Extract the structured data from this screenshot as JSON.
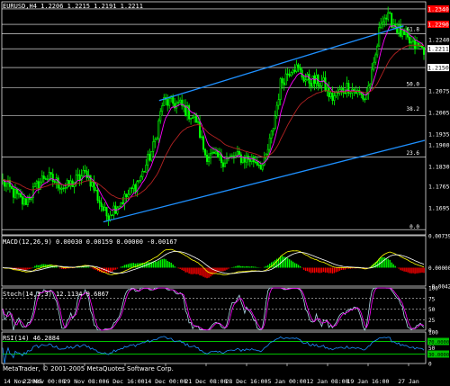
{
  "chart_data": [
    {
      "type": "candlestick",
      "panel": "price",
      "title": "EURUSD,H4  1.2206 1.2215 1.2191 1.2211",
      "ylim": [
        1.1608,
        1.2363
      ],
      "y_ticks": [
        "1.2340",
        "1.2290",
        "1.2240",
        "1.2211",
        "1.2150",
        "1.2075",
        "1.2005",
        "1.1935",
        "1.1900",
        "1.1830",
        "1.1765",
        "1.1695"
      ],
      "price_tags": [
        {
          "label": "1.2340",
          "value": 1.234,
          "color": "#ff0000"
        },
        {
          "label": "1.2290",
          "value": 1.229,
          "color": "#ff0000"
        },
        {
          "label": "1.2211",
          "value": 1.2211,
          "color": "#ffffff"
        },
        {
          "label": "1.2150",
          "value": 1.215,
          "color": "#ffffff"
        }
      ],
      "horizontal_lines": [
        1.234,
        1.229,
        1.226,
        1.2211,
        1.215,
        1.2085,
        1.1995,
        1.186,
        1.1625
      ],
      "fibonacci_levels": [
        {
          "label": "61.8",
          "value": 1.2262
        },
        {
          "label": "50.0",
          "value": 1.2085
        },
        {
          "label": "38.2",
          "value": 1.2004
        },
        {
          "label": "23.6",
          "value": 1.1862
        },
        {
          "label": "0.0",
          "value": 1.1622
        }
      ],
      "channel_lines": [
        {
          "name": "upper",
          "points": [
            [
              0.372,
              1.2043
            ],
            [
              0.95,
              1.2285
            ]
          ],
          "color": "#1e90ff"
        },
        {
          "name": "lower",
          "points": [
            [
              0.24,
              1.165
            ],
            [
              1.0,
              1.1914
            ]
          ],
          "color": "#1e90ff"
        }
      ],
      "ohlc_anchors": [
        [
          0.0,
          1.178
        ],
        [
          0.05,
          1.171
        ],
        [
          0.1,
          1.18
        ],
        [
          0.15,
          1.176
        ],
        [
          0.2,
          1.181
        ],
        [
          0.245,
          1.167
        ],
        [
          0.3,
          1.174
        ],
        [
          0.33,
          1.18
        ],
        [
          0.36,
          1.19
        ],
        [
          0.38,
          1.204
        ],
        [
          0.42,
          1.203
        ],
        [
          0.46,
          1.198
        ],
        [
          0.48,
          1.187
        ],
        [
          0.52,
          1.185
        ],
        [
          0.56,
          1.186
        ],
        [
          0.6,
          1.185
        ],
        [
          0.62,
          1.183
        ],
        [
          0.64,
          1.194
        ],
        [
          0.66,
          1.21
        ],
        [
          0.69,
          1.216
        ],
        [
          0.72,
          1.211
        ],
        [
          0.76,
          1.21
        ],
        [
          0.78,
          1.205
        ],
        [
          0.82,
          1.209
        ],
        [
          0.86,
          1.205
        ],
        [
          0.88,
          1.214
        ],
        [
          0.9,
          1.232
        ],
        [
          0.925,
          1.23
        ],
        [
          0.95,
          1.225
        ],
        [
          0.975,
          1.222
        ],
        [
          1.0,
          1.2211
        ]
      ],
      "moving_averages": [
        {
          "name": "fast",
          "color": "#ff00ff"
        },
        {
          "name": "slow",
          "color": "#b22222"
        }
      ],
      "candle_color": "#00ff00"
    },
    {
      "type": "bar",
      "panel": "macd",
      "title": "MACD(12,26,9) 0.00030 0.00159 0.00000 -0.00167",
      "y_ticks": [
        "0.00739",
        "0.00000",
        "-0.00427"
      ],
      "ylim": [
        -0.00427,
        0.00739
      ],
      "histogram_colors": {
        "positive": "#00ff00",
        "negative": "#ff0000"
      },
      "series": [
        {
          "name": "main",
          "color": "#ffff00"
        },
        {
          "name": "signal",
          "color": "#ffffff"
        }
      ]
    },
    {
      "type": "line",
      "panel": "stochastic",
      "title": "Stoch(14,3,3) 12.1134 9.6867",
      "y_ticks": [
        "100",
        "75",
        "50",
        "25",
        "0"
      ],
      "ylim": [
        0,
        100
      ],
      "series": [
        {
          "name": "main",
          "color": "#add8e6"
        },
        {
          "name": "signal",
          "color": "#ff00ff"
        }
      ]
    },
    {
      "type": "line",
      "panel": "rsi",
      "title": "RSI(14) 46.2884",
      "y_ticks": [
        "100",
        "70.0000",
        "50",
        "30.0000",
        "0"
      ],
      "ylim": [
        0,
        100
      ],
      "levels": [
        70,
        30
      ],
      "series": [
        {
          "name": "rsi",
          "color": "#1e90ff"
        }
      ]
    }
  ],
  "copyright": "MetaTrader, © 2001-2005 MetaQuotes Software Corp.",
  "x_axis_labels": [
    "14 Nov 2005",
    "22 Nov 00:00",
    "29 Nov 08:00",
    "6 Dec 16:00",
    "14 Dec 00:00",
    "21 Dec 08:00",
    "28 Dec 16:00",
    "5 Jan 00:00",
    "12 Jan 08:00",
    "19 Jan 16:00",
    "27 Jan"
  ]
}
